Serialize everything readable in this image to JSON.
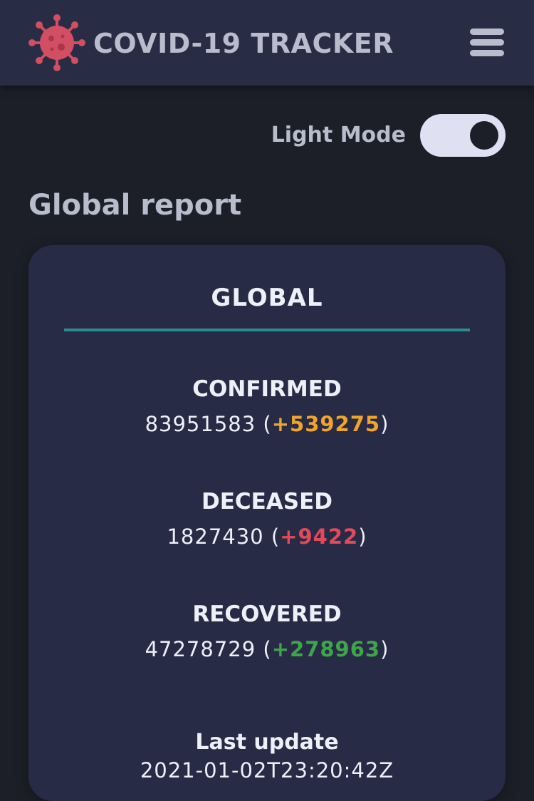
{
  "header": {
    "title": "COVID-19 TRACKER",
    "logo_icon": "virus-icon",
    "logo_color": "#d24e63",
    "menu_icon": "hamburger-menu-icon"
  },
  "theme_toggle": {
    "label": "Light Mode",
    "state": "off"
  },
  "section": {
    "title": "Global report"
  },
  "report_card": {
    "title": "GLOBAL",
    "stats": [
      {
        "label": "CONFIRMED",
        "value": "83951583",
        "delta": "+539275",
        "delta_color": "#f0a52a"
      },
      {
        "label": "DECEASED",
        "value": "1827430",
        "delta": "+9422",
        "delta_color": "#e2495a"
      },
      {
        "label": "RECOVERED",
        "value": "47278729",
        "delta": "+278963",
        "delta_color": "#3fa54a"
      }
    ],
    "last_update_label": "Last update",
    "last_update_value": "2021-01-02T23:20:42Z"
  },
  "colors": {
    "accent_divider": "#2f8b92",
    "background": "#1d1f28",
    "header_bg": "#282c44",
    "card_bg": "#272b45"
  }
}
